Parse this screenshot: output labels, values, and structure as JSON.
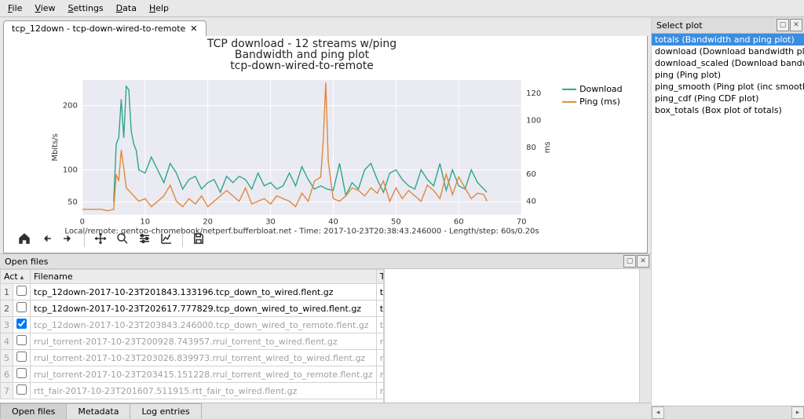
{
  "menu": [
    "File",
    "View",
    "Settings",
    "Data",
    "Help"
  ],
  "tab": {
    "label": "tcp_12down - tcp-down-wired-to-remote",
    "close_glyph": "✕"
  },
  "toolbar_icons": [
    "home",
    "back",
    "forward",
    "|",
    "pan",
    "zoom",
    "sliders",
    "chart",
    "|",
    "save"
  ],
  "right_panel": {
    "title": "Select plot",
    "items": [
      {
        "label": "totals (Bandwidth and ping plot)",
        "selected": true
      },
      {
        "label": "download (Download bandwidth plot)"
      },
      {
        "label": "download_scaled (Download bandwidth w/axes"
      },
      {
        "label": "ping (Ping plot)"
      },
      {
        "label": "ping_smooth (Ping plot (inc smoothed average)"
      },
      {
        "label": "ping_cdf (Ping CDF plot)"
      },
      {
        "label": "box_totals (Box plot of totals)"
      }
    ]
  },
  "lower": {
    "title": "Open files",
    "headers": {
      "act": "Act",
      "filename": "Filename",
      "title": "Title"
    },
    "rows": [
      {
        "n": "1",
        "checked": false,
        "dim": false,
        "filename": "tcp_12down-2017-10-23T201843.133196.tcp_down_to_wired.flent.gz",
        "title": "tcp-down-to-wired"
      },
      {
        "n": "2",
        "checked": false,
        "dim": false,
        "filename": "tcp_12down-2017-10-23T202617.777829.tcp_down_wired_to_wired.flent.gz",
        "title": "tcp-down-wired-to-wired"
      },
      {
        "n": "3",
        "checked": true,
        "dim": true,
        "filename": "tcp_12down-2017-10-23T203843.246000.tcp_down_wired_to_remote.flent.gz",
        "title": "tcp-down-wired-to-remote"
      },
      {
        "n": "4",
        "checked": false,
        "dim": true,
        "filename": "rrul_torrent-2017-10-23T200928.743957.rrul_torrent_to_wired.flent.gz",
        "title": "rrul-torrent-to-wired"
      },
      {
        "n": "5",
        "checked": false,
        "dim": true,
        "filename": "rrul_torrent-2017-10-23T203026.839973.rrul_torrent_wired_to_wired.flent.gz",
        "title": "rrul-torrent-wired-to-wired"
      },
      {
        "n": "6",
        "checked": false,
        "dim": true,
        "filename": "rrul_torrent-2017-10-23T203415.151228.rrul_torrent_wired_to_remote.flent.gz",
        "title": "rrul-torrent-wired-to-remote"
      },
      {
        "n": "7",
        "checked": false,
        "dim": true,
        "filename": "rtt_fair-2017-10-23T201607.511915.rtt_fair_to_wired.flent.gz",
        "title": "rtt-fair-to-wired"
      }
    ],
    "tabs": [
      "Open files",
      "Metadata",
      "Log entries"
    ],
    "active_tab": 0
  },
  "chart_data": {
    "type": "line",
    "title_lines": [
      "TCP download - 12 streams w/ping",
      "Bandwidth and ping plot",
      "tcp-down-wired-to-remote"
    ],
    "xlabel_footer": "Local/remote: gentoo-chromebook/netperf.bufferbloat.net - Time: 2017-10-23T20:38:43.246000 - Length/step: 60s/0.20s",
    "xlim": [
      0,
      70
    ],
    "xticks": [
      0,
      10,
      20,
      30,
      40,
      50,
      60,
      70
    ],
    "y_left": {
      "label": "Mbits/s",
      "lim": [
        30,
        240
      ],
      "ticks": [
        50,
        100,
        200
      ]
    },
    "y_right": {
      "label": "ms",
      "lim": [
        30,
        130
      ],
      "ticks": [
        40,
        60,
        80,
        100,
        120
      ]
    },
    "legend": [
      {
        "name": "Download",
        "axis": "left",
        "color": "#2fa58b"
      },
      {
        "name": "Ping (ms)",
        "axis": "right",
        "color": "#e0883a"
      }
    ],
    "series": [
      {
        "name": "Download",
        "axis": "left",
        "color": "#2fa58b",
        "x": [
          5,
          5.4,
          5.8,
          6.2,
          6.6,
          7,
          7.4,
          7.8,
          8.2,
          8.6,
          9,
          10,
          11,
          12,
          13,
          14,
          15,
          16,
          17,
          18,
          19,
          20,
          21,
          22,
          23,
          24,
          25,
          26,
          27,
          28,
          29,
          30,
          31,
          32,
          33,
          34,
          35,
          36,
          37,
          38,
          39,
          40,
          41,
          42,
          43,
          44,
          45,
          46,
          47,
          48,
          49,
          50,
          51,
          52,
          53,
          54,
          55,
          56,
          57,
          58,
          59,
          60,
          61,
          62,
          63,
          64,
          64.5
        ],
        "y": [
          50,
          140,
          150,
          210,
          150,
          230,
          225,
          160,
          140,
          130,
          100,
          95,
          120,
          100,
          80,
          110,
          95,
          70,
          85,
          90,
          70,
          80,
          85,
          65,
          90,
          80,
          90,
          85,
          70,
          95,
          75,
          80,
          70,
          75,
          95,
          75,
          105,
          85,
          70,
          75,
          70,
          68,
          110,
          60,
          80,
          70,
          100,
          110,
          85,
          65,
          95,
          100,
          85,
          75,
          70,
          100,
          85,
          75,
          110,
          68,
          100,
          75,
          70,
          100,
          80,
          70,
          65
        ]
      },
      {
        "name": "Ping (ms)",
        "axis": "right",
        "color": "#e0883a",
        "x": [
          0,
          1,
          2,
          3,
          4,
          5,
          5.4,
          5.8,
          6.2,
          6.6,
          7,
          8,
          9,
          10,
          11,
          12,
          13,
          14,
          15,
          16,
          17,
          18,
          19,
          20,
          21,
          22,
          23,
          24,
          25,
          26,
          27,
          28,
          29,
          30,
          31,
          32,
          33,
          34,
          35,
          36,
          37,
          38,
          38.4,
          38.8,
          39.2,
          39.6,
          40,
          41,
          42,
          43,
          44,
          45,
          46,
          47,
          48,
          49,
          50,
          51,
          52,
          53,
          54,
          55,
          56,
          57,
          58,
          59,
          60,
          61,
          62,
          63,
          64,
          64.5
        ],
        "y": [
          34,
          34,
          34,
          34,
          33,
          34,
          60,
          55,
          78,
          65,
          50,
          45,
          40,
          42,
          36,
          40,
          44,
          52,
          40,
          36,
          42,
          38,
          44,
          36,
          40,
          44,
          48,
          44,
          40,
          50,
          38,
          40,
          42,
          38,
          44,
          42,
          40,
          36,
          46,
          40,
          55,
          58,
          85,
          128,
          70,
          55,
          42,
          40,
          44,
          50,
          48,
          44,
          50,
          46,
          55,
          40,
          50,
          42,
          48,
          44,
          40,
          52,
          48,
          42,
          60,
          45,
          58,
          50,
          42,
          46,
          45,
          40
        ]
      }
    ]
  }
}
